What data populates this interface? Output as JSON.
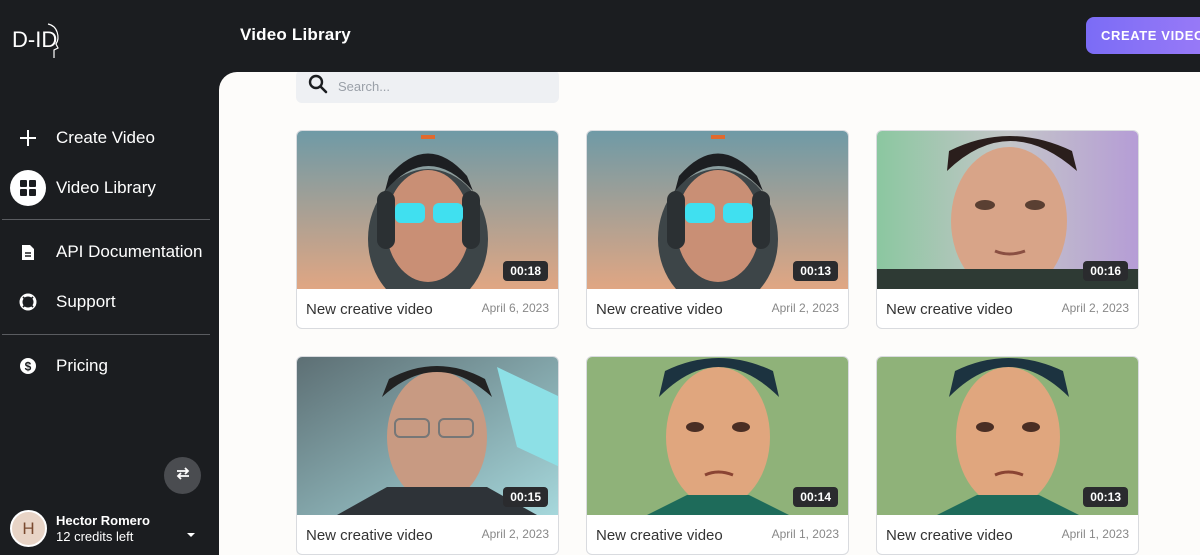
{
  "app": {
    "logo_text": "D-ID",
    "page_title": "Video Library",
    "create_button": "CREATE VIDEO"
  },
  "sidebar": {
    "items": [
      {
        "label": "Create Video",
        "icon": "plus-icon",
        "active": false
      },
      {
        "label": "Video Library",
        "icon": "grid-icon",
        "active": true
      },
      {
        "label": "API Documentation",
        "icon": "document-icon",
        "active": false
      },
      {
        "label": "Support",
        "icon": "lifebuoy-icon",
        "active": false
      },
      {
        "label": "Pricing",
        "icon": "dollar-icon",
        "active": false
      }
    ]
  },
  "user": {
    "initial": "H",
    "name": "Hector Romero",
    "credits": "12 credits left"
  },
  "search": {
    "placeholder": "Search..."
  },
  "videos": [
    {
      "title": "New creative video",
      "date": "April 6, 2023",
      "duration": "00:18"
    },
    {
      "title": "New creative video",
      "date": "April 2, 2023",
      "duration": "00:13"
    },
    {
      "title": "New creative video",
      "date": "April 2, 2023",
      "duration": "00:16"
    },
    {
      "title": "New creative video",
      "date": "April 2, 2023",
      "duration": "00:15"
    },
    {
      "title": "New creative video",
      "date": "April 1, 2023",
      "duration": "00:14"
    },
    {
      "title": "New creative video",
      "date": "April 1, 2023",
      "duration": "00:13"
    }
  ],
  "colors": {
    "background": "#1b1d20",
    "accent": "#7b6cf6",
    "main_background": "#fdfcfa"
  }
}
